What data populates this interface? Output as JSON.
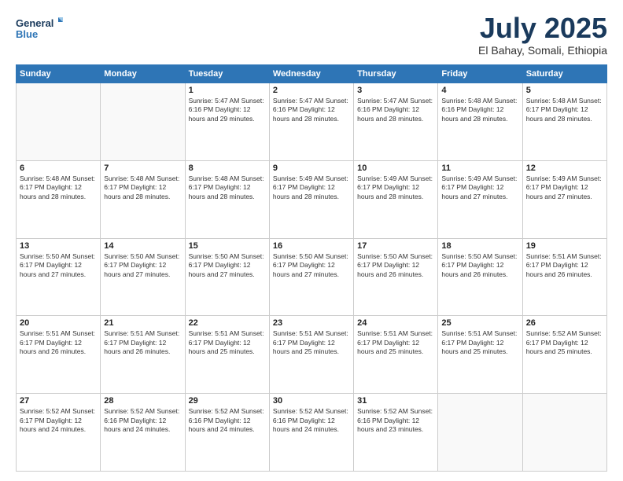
{
  "header": {
    "logo_line1": "General",
    "logo_line2": "Blue",
    "month_title": "July 2025",
    "subtitle": "El Bahay, Somali, Ethiopia"
  },
  "weekdays": [
    "Sunday",
    "Monday",
    "Tuesday",
    "Wednesday",
    "Thursday",
    "Friday",
    "Saturday"
  ],
  "weeks": [
    [
      {
        "day": "",
        "info": ""
      },
      {
        "day": "",
        "info": ""
      },
      {
        "day": "1",
        "info": "Sunrise: 5:47 AM\nSunset: 6:16 PM\nDaylight: 12 hours\nand 29 minutes."
      },
      {
        "day": "2",
        "info": "Sunrise: 5:47 AM\nSunset: 6:16 PM\nDaylight: 12 hours\nand 28 minutes."
      },
      {
        "day": "3",
        "info": "Sunrise: 5:47 AM\nSunset: 6:16 PM\nDaylight: 12 hours\nand 28 minutes."
      },
      {
        "day": "4",
        "info": "Sunrise: 5:48 AM\nSunset: 6:16 PM\nDaylight: 12 hours\nand 28 minutes."
      },
      {
        "day": "5",
        "info": "Sunrise: 5:48 AM\nSunset: 6:17 PM\nDaylight: 12 hours\nand 28 minutes."
      }
    ],
    [
      {
        "day": "6",
        "info": "Sunrise: 5:48 AM\nSunset: 6:17 PM\nDaylight: 12 hours\nand 28 minutes."
      },
      {
        "day": "7",
        "info": "Sunrise: 5:48 AM\nSunset: 6:17 PM\nDaylight: 12 hours\nand 28 minutes."
      },
      {
        "day": "8",
        "info": "Sunrise: 5:48 AM\nSunset: 6:17 PM\nDaylight: 12 hours\nand 28 minutes."
      },
      {
        "day": "9",
        "info": "Sunrise: 5:49 AM\nSunset: 6:17 PM\nDaylight: 12 hours\nand 28 minutes."
      },
      {
        "day": "10",
        "info": "Sunrise: 5:49 AM\nSunset: 6:17 PM\nDaylight: 12 hours\nand 28 minutes."
      },
      {
        "day": "11",
        "info": "Sunrise: 5:49 AM\nSunset: 6:17 PM\nDaylight: 12 hours\nand 27 minutes."
      },
      {
        "day": "12",
        "info": "Sunrise: 5:49 AM\nSunset: 6:17 PM\nDaylight: 12 hours\nand 27 minutes."
      }
    ],
    [
      {
        "day": "13",
        "info": "Sunrise: 5:50 AM\nSunset: 6:17 PM\nDaylight: 12 hours\nand 27 minutes."
      },
      {
        "day": "14",
        "info": "Sunrise: 5:50 AM\nSunset: 6:17 PM\nDaylight: 12 hours\nand 27 minutes."
      },
      {
        "day": "15",
        "info": "Sunrise: 5:50 AM\nSunset: 6:17 PM\nDaylight: 12 hours\nand 27 minutes."
      },
      {
        "day": "16",
        "info": "Sunrise: 5:50 AM\nSunset: 6:17 PM\nDaylight: 12 hours\nand 27 minutes."
      },
      {
        "day": "17",
        "info": "Sunrise: 5:50 AM\nSunset: 6:17 PM\nDaylight: 12 hours\nand 26 minutes."
      },
      {
        "day": "18",
        "info": "Sunrise: 5:50 AM\nSunset: 6:17 PM\nDaylight: 12 hours\nand 26 minutes."
      },
      {
        "day": "19",
        "info": "Sunrise: 5:51 AM\nSunset: 6:17 PM\nDaylight: 12 hours\nand 26 minutes."
      }
    ],
    [
      {
        "day": "20",
        "info": "Sunrise: 5:51 AM\nSunset: 6:17 PM\nDaylight: 12 hours\nand 26 minutes."
      },
      {
        "day": "21",
        "info": "Sunrise: 5:51 AM\nSunset: 6:17 PM\nDaylight: 12 hours\nand 26 minutes."
      },
      {
        "day": "22",
        "info": "Sunrise: 5:51 AM\nSunset: 6:17 PM\nDaylight: 12 hours\nand 25 minutes."
      },
      {
        "day": "23",
        "info": "Sunrise: 5:51 AM\nSunset: 6:17 PM\nDaylight: 12 hours\nand 25 minutes."
      },
      {
        "day": "24",
        "info": "Sunrise: 5:51 AM\nSunset: 6:17 PM\nDaylight: 12 hours\nand 25 minutes."
      },
      {
        "day": "25",
        "info": "Sunrise: 5:51 AM\nSunset: 6:17 PM\nDaylight: 12 hours\nand 25 minutes."
      },
      {
        "day": "26",
        "info": "Sunrise: 5:52 AM\nSunset: 6:17 PM\nDaylight: 12 hours\nand 25 minutes."
      }
    ],
    [
      {
        "day": "27",
        "info": "Sunrise: 5:52 AM\nSunset: 6:17 PM\nDaylight: 12 hours\nand 24 minutes."
      },
      {
        "day": "28",
        "info": "Sunrise: 5:52 AM\nSunset: 6:16 PM\nDaylight: 12 hours\nand 24 minutes."
      },
      {
        "day": "29",
        "info": "Sunrise: 5:52 AM\nSunset: 6:16 PM\nDaylight: 12 hours\nand 24 minutes."
      },
      {
        "day": "30",
        "info": "Sunrise: 5:52 AM\nSunset: 6:16 PM\nDaylight: 12 hours\nand 24 minutes."
      },
      {
        "day": "31",
        "info": "Sunrise: 5:52 AM\nSunset: 6:16 PM\nDaylight: 12 hours\nand 23 minutes."
      },
      {
        "day": "",
        "info": ""
      },
      {
        "day": "",
        "info": ""
      }
    ]
  ]
}
